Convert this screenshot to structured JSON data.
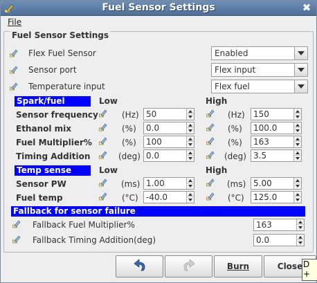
{
  "window": {
    "title": "Fuel Sensor Settings",
    "icon": "edit-pencil-icon",
    "close": "✖"
  },
  "menu": {
    "file": "File"
  },
  "panel": {
    "legend": "Fuel Sensor Settings"
  },
  "settings": [
    {
      "label": "Flex Fuel Sensor",
      "value": "Enabled"
    },
    {
      "label": "Sensor port",
      "value": "Flex input"
    },
    {
      "label": "Temperature input",
      "value": "Flex fuel"
    }
  ],
  "spark_fuel": {
    "header": "Spark/fuel",
    "low_header": "Low",
    "high_header": "High",
    "rows": [
      {
        "label": "Sensor frequency",
        "unit": "(Hz)",
        "low": "50",
        "high": "150"
      },
      {
        "label": "Ethanol mix",
        "unit": "(%)",
        "low": "0.0",
        "high": "100.0"
      },
      {
        "label": "Fuel Multiplier%",
        "unit": "(%)",
        "low": "100",
        "high": "163"
      },
      {
        "label": "Timing Addition",
        "unit": "(deg)",
        "low": "0.0",
        "high": "3.5"
      }
    ]
  },
  "temp_sense": {
    "header": "Temp sense",
    "low_header": "Low",
    "high_header": "High",
    "rows": [
      {
        "label": "Sensor PW",
        "unit": "(ms)",
        "low": "1.00",
        "high": "5.00"
      },
      {
        "label": "Fuel temp",
        "unit": "(°C)",
        "low": "-40.0",
        "high": "125.0"
      }
    ]
  },
  "fallback": {
    "header": "Fallback for sensor failure",
    "rows": [
      {
        "label": "Fallback Fuel Multiplier%",
        "value": "163"
      },
      {
        "label": "Fallback Timing Addition(deg)",
        "value": "0.0"
      }
    ]
  },
  "buttons": {
    "undo": "undo-icon",
    "redo": "redo-icon",
    "burn": "Burn",
    "close": "Close"
  },
  "tooltip": {
    "line1": "D",
    "line2": "+ o"
  },
  "colors": {
    "section": "#0000ff",
    "titlebar": "#5a7aa5"
  }
}
